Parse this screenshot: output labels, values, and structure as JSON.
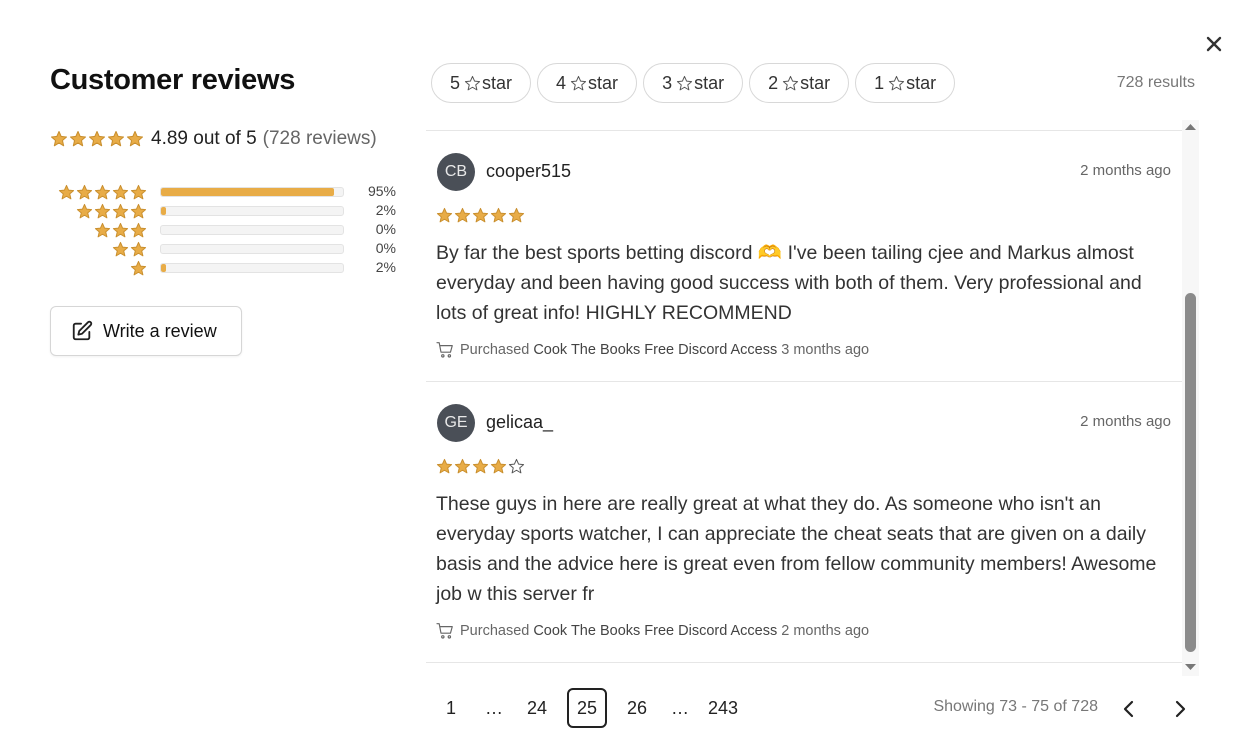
{
  "header": {
    "title": "Customer reviews",
    "close_icon": "close-icon"
  },
  "summary": {
    "rating": 4.89,
    "rating_text": "4.89 out of 5",
    "count_text": "(728 reviews)"
  },
  "distribution": [
    {
      "stars": 5,
      "percent": 95,
      "label": "95%"
    },
    {
      "stars": 4,
      "percent": 2,
      "label": "2%"
    },
    {
      "stars": 3,
      "percent": 0,
      "label": "0%"
    },
    {
      "stars": 2,
      "percent": 0,
      "label": "0%"
    },
    {
      "stars": 1,
      "percent": 2,
      "label": "2%"
    }
  ],
  "write_review": {
    "label": "Write a review",
    "icon": "edit-icon"
  },
  "filters": {
    "chips": [
      {
        "number": "5",
        "label": "star"
      },
      {
        "number": "4",
        "label": "star"
      },
      {
        "number": "3",
        "label": "star"
      },
      {
        "number": "2",
        "label": "star"
      },
      {
        "number": "1",
        "label": "star"
      }
    ],
    "results_text": "728 results"
  },
  "reviews": [
    {
      "initials": "CB",
      "username": "cooper515",
      "date": "2 months ago",
      "rating": 5,
      "text": "By far the best sports betting discord 🫶 I've been tailing cjee and Markus almost everyday and been having good success with both of them. Very professional and lots of great info! HIGHLY RECOMMEND",
      "purchased_label": "Purchased",
      "product": "Cook The Books Free Discord Access",
      "purchased_when": "3 months ago"
    },
    {
      "initials": "GE",
      "username": "gelicaa_",
      "date": "2 months ago",
      "rating": 4,
      "text": "These guys in here are really great at what they do. As someone who isn't an everyday sports watcher, I can appreciate the cheat seats that are given on a daily basis and the advice here is great even from fellow community members! Awesome job w this server fr",
      "purchased_label": "Purchased",
      "product": "Cook The Books Free Discord Access",
      "purchased_when": "2 months ago"
    }
  ],
  "pagination": {
    "pages": [
      "1",
      "…",
      "24",
      "25",
      "26",
      "…",
      "243"
    ],
    "current": "25",
    "showing_text": "Showing 73 - 75 of 728"
  },
  "colors": {
    "star": "#e8ac47",
    "star_stroke": "#c98f2e",
    "avatar_bg": "#4a4f57"
  }
}
